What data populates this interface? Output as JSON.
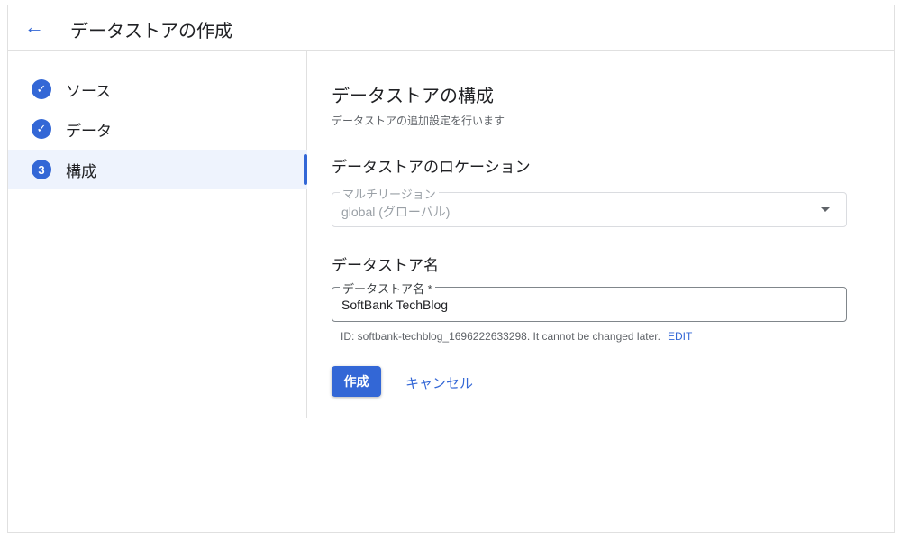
{
  "header": {
    "title": "データストアの作成"
  },
  "steps": [
    {
      "label": "ソース",
      "status": "done"
    },
    {
      "label": "データ",
      "status": "done"
    },
    {
      "label": "構成",
      "status": "active",
      "number": "3"
    }
  ],
  "main": {
    "title": "データストアの構成",
    "subtitle": "データストアの追加設定を行います",
    "location_heading": "データストアのロケーション",
    "location_field": {
      "label": "マルチリージョン",
      "value": "global (グローバル)"
    },
    "name_heading": "データストア名",
    "name_field": {
      "label": "データストア名 *",
      "value": "SoftBank TechBlog"
    },
    "id_help": "ID: softbank-techblog_1696222633298. It cannot be changed later.",
    "edit_label": "EDIT",
    "create_label": "作成",
    "cancel_label": "キャンセル"
  },
  "colors": {
    "accent": "#3367d6"
  }
}
